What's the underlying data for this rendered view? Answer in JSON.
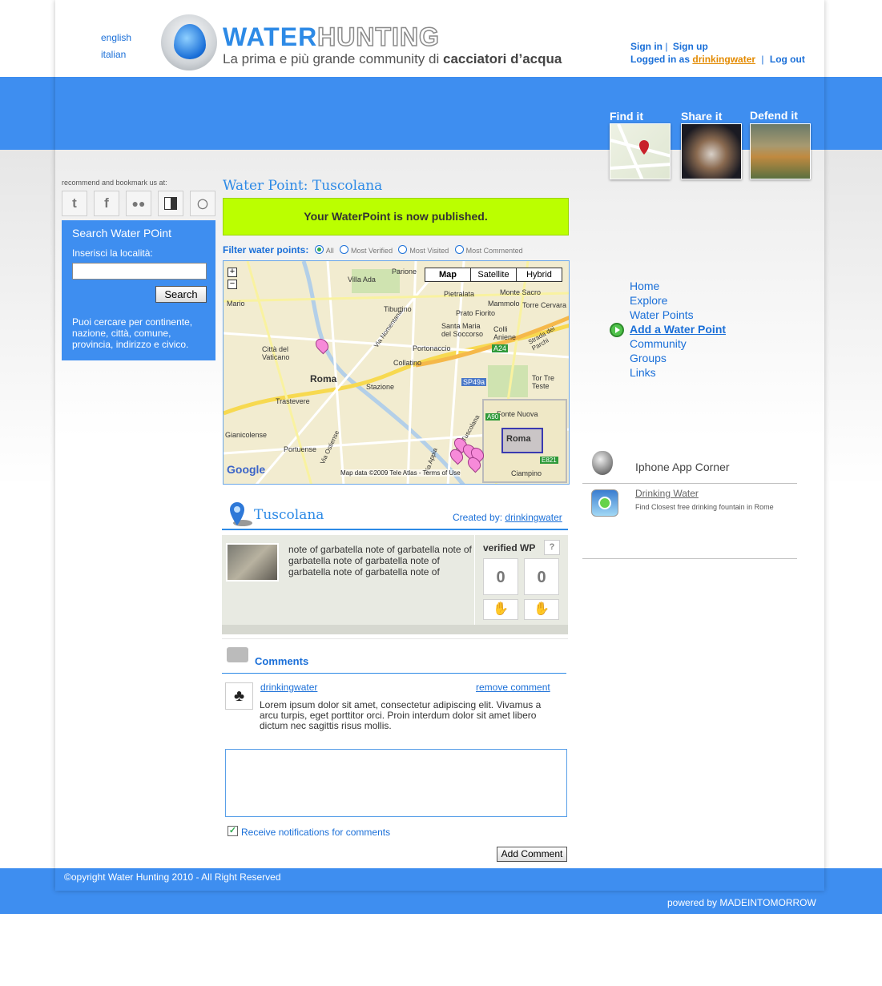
{
  "languages": [
    "english",
    "italian"
  ],
  "brand": {
    "part1": "WATER",
    "part2": "HUNTING",
    "tagline_start": "La prima e più grande community di ",
    "tagline_bold": "cacciatori d’acqua"
  },
  "auth": {
    "sign_in": "Sign in",
    "sep": "|",
    "sign_up": "Sign up",
    "logged_prefix": "Logged in as",
    "username": "drinkingwater",
    "logout": "Log out"
  },
  "banner": {
    "find": "Find it",
    "share": "Share it",
    "defend": "Defend it"
  },
  "social": {
    "label": "recommend and bookmark us at:",
    "icons": [
      "twitter-icon",
      "facebook-icon",
      "myspace-icon",
      "delicious-icon",
      "other-icon"
    ]
  },
  "search": {
    "title": "Search Water POint",
    "label": "Inserisci la località:",
    "value": "",
    "button": "Search",
    "help": "Puoi cercare per continente, nazione, città, comune, provincia, indirizzo e civico."
  },
  "main": {
    "title": "Water Point: Tuscolana",
    "published": "Your WaterPoint is now published.",
    "filter_label": "Filter water points:",
    "filters": [
      "All",
      "Most Verified",
      "Most Visited",
      "Most Commented"
    ],
    "map": {
      "types": [
        "Map",
        "Satellite",
        "Hybrid"
      ],
      "zoom_in": "+",
      "zoom_out": "−",
      "labels": [
        "Villa Ada",
        "Parione",
        "Monte Sacro",
        "Mario",
        "Pietralata",
        "Tiburtino",
        "Prato Fiorito",
        "Mammolo",
        "Torre Cervara",
        "Città del Vaticano",
        "Roma",
        "Portonaccio",
        "Santa Maria del Soccorso",
        "Collatino",
        "Colli Aniene",
        "Via Nomentana",
        "Strada dei Parchi",
        "A24",
        "SP49a",
        "Tor Tre Teste",
        "Trastevere",
        "Stazione",
        "Fonte Nuova",
        "A90",
        "Roma",
        "E821",
        "Ciampino",
        "Portuense",
        "Gianicolense",
        "Via Ostiense",
        "Via Appia",
        "Via Tuscolana"
      ],
      "google": "Google",
      "attribution": "Map data ©2009 Tele Atlas - Terms of Use"
    },
    "point": {
      "name": "Tuscolana",
      "created_by_label": "Created by:",
      "created_by": "drinkingwater",
      "note": "note of garbatella note of garbatella note of garbatella note of garbatella note of garbatella note of garbatella note of",
      "verified_label": "verified WP",
      "help": "?",
      "up_votes": "0",
      "down_votes": "0"
    },
    "comments": {
      "title": "Comments",
      "items": [
        {
          "author": "drinkingwater",
          "remove": "remove comment",
          "text": "Lorem ipsum dolor sit amet, consectetur adipiscing elit. Vivamus a arcu turpis, eget porttitor orci. Proin interdum dolor sit amet libero dictum nec sagittis risus mollis."
        }
      ],
      "notify_label": "Receive notifications for comments",
      "notify_checked": true,
      "textarea_value": "",
      "submit": "Add Comment"
    }
  },
  "nav": {
    "items": [
      "Home",
      "Explore",
      "Water Points",
      "Add a Water Point",
      "Community",
      "Groups",
      "Links"
    ],
    "active_index": 3
  },
  "iphone": {
    "title": "Iphone App Corner",
    "app_name": "Drinking Water",
    "app_desc": "Find Closest free drinking fountain in Rome"
  },
  "footer": {
    "copyright": "©opyright Water Hunting 2010 - All Right Reserved",
    "powered": "powered by MADEINTOMORROW"
  },
  "colors": {
    "accent": "#3e8ef0",
    "link": "#1a6fd8",
    "success": "#bbff00",
    "user_link": "#e38a00"
  }
}
